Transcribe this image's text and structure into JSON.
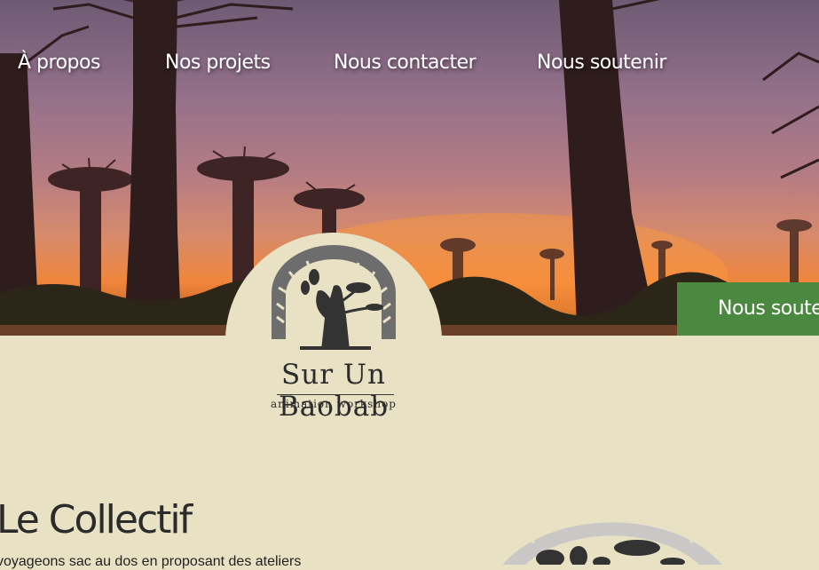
{
  "nav": {
    "items": [
      {
        "label": "À propos"
      },
      {
        "label": "Nos projets"
      },
      {
        "label": "Nous contacter"
      },
      {
        "label": "Nous soutenir"
      }
    ]
  },
  "cta": {
    "label": "Nous soutenir"
  },
  "logo": {
    "title": "Sur Un Baobab",
    "subtitle": "animation workshop"
  },
  "collectif": {
    "title": "Le Collectif",
    "text": "voyageons sac au dos en proposant des ateliers"
  },
  "colors": {
    "background": "#e8e1c4",
    "cta": "#4b8840",
    "logo_gray": "#6d6d6d",
    "logo_dark": "#333333",
    "emblem_light": "#c9c8c6"
  }
}
